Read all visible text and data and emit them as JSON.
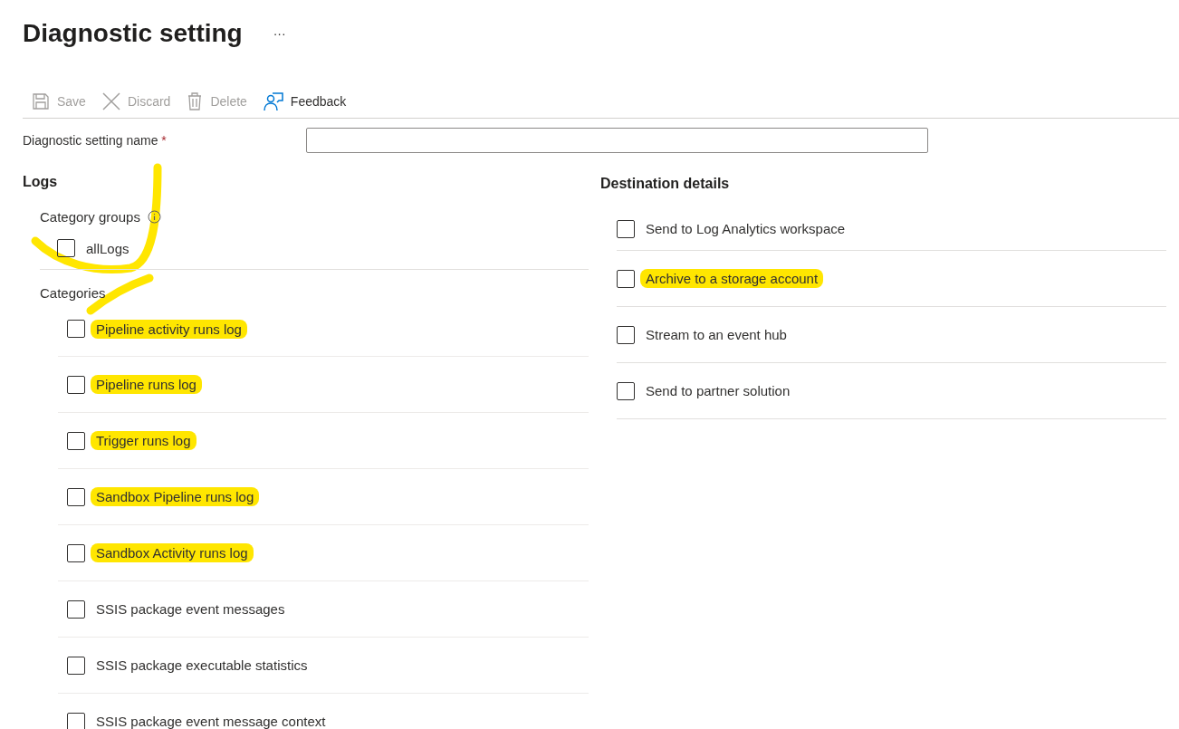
{
  "title": "Diagnostic setting",
  "more": "···",
  "toolbar": [
    {
      "kind": "save",
      "label": "Save",
      "disabled": true
    },
    {
      "kind": "discard",
      "label": "Discard",
      "disabled": true
    },
    {
      "kind": "delete",
      "label": "Delete",
      "disabled": true
    },
    {
      "kind": "feedback",
      "label": "Feedback",
      "disabled": false
    }
  ],
  "name_field": {
    "label": "Diagnostic setting name",
    "required_mark": "*"
  },
  "logs": {
    "heading": "Logs",
    "category_groups": {
      "label": "Category groups",
      "marked": true,
      "items": [
        {
          "label": "allLogs",
          "checked": false,
          "highlighted": false
        }
      ]
    },
    "categories": {
      "label": "Categories",
      "marked": true,
      "items": [
        {
          "label": "Pipeline activity runs log",
          "checked": false,
          "highlighted": true
        },
        {
          "label": "Pipeline runs log",
          "checked": false,
          "highlighted": true
        },
        {
          "label": "Trigger runs log",
          "checked": false,
          "highlighted": true
        },
        {
          "label": "Sandbox Pipeline runs log",
          "checked": false,
          "highlighted": true
        },
        {
          "label": "Sandbox Activity runs log",
          "checked": false,
          "highlighted": true
        },
        {
          "label": "SSIS package event messages",
          "checked": false,
          "highlighted": false
        },
        {
          "label": "SSIS package executable statistics",
          "checked": false,
          "highlighted": false
        },
        {
          "label": "SSIS package event message context",
          "checked": false,
          "highlighted": false
        }
      ]
    }
  },
  "destination": {
    "heading": "Destination details",
    "items": [
      {
        "label": "Send to Log Analytics workspace",
        "checked": false,
        "highlighted": false
      },
      {
        "label": "Archive to a storage account",
        "checked": false,
        "highlighted": true
      },
      {
        "label": "Stream to an event hub",
        "checked": false,
        "highlighted": false
      },
      {
        "label": "Send to partner solution",
        "checked": false,
        "highlighted": false
      }
    ]
  }
}
